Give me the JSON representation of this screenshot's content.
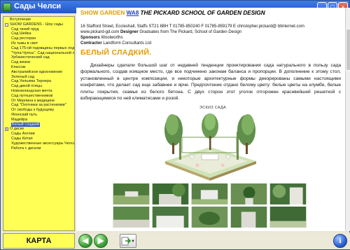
{
  "window": {
    "title": "Сады Челси"
  },
  "sidebar": {
    "items": [
      {
        "label": "Вступление",
        "indent": 0,
        "box": ""
      },
      {
        "label": "SHOW GARDENS - Шоу сады",
        "indent": 0,
        "box": "−"
      },
      {
        "label": "Сад тихий пруд",
        "indent": 1,
        "box": ""
      },
      {
        "label": "Сад Шейка",
        "indent": 1,
        "box": ""
      },
      {
        "label": "Сад ресторан",
        "indent": 1,
        "box": ""
      },
      {
        "label": "Из тьмы в свет",
        "indent": 1,
        "box": ""
      },
      {
        "label": "Сад 175-ой годовщины первых лодок",
        "indent": 1,
        "box": ""
      },
      {
        "label": "\"Чупа-Чупсы\". Сад национальной лот",
        "indent": 1,
        "box": ""
      },
      {
        "label": "Урбанистический сад",
        "indent": 1,
        "box": ""
      },
      {
        "label": "Сад жизни",
        "indent": 1,
        "box": ""
      },
      {
        "label": "Классик",
        "indent": 1,
        "box": ""
      },
      {
        "label": "Австралийское вдохновение",
        "indent": 1,
        "box": ""
      },
      {
        "label": "Зеленый сад",
        "indent": 1,
        "box": ""
      },
      {
        "label": "Сад Уильяма Тернера",
        "indent": 1,
        "box": ""
      },
      {
        "label": "Сад дикой птицы",
        "indent": 1,
        "box": ""
      },
      {
        "label": "Новозеландская мечта",
        "indent": 1,
        "box": ""
      },
      {
        "label": "Сад путешественников",
        "indent": 1,
        "box": ""
      },
      {
        "label": "От Мерлина к медицине",
        "indent": 1,
        "box": ""
      },
      {
        "label": "Сад \"Охотники за растениями\"",
        "indent": 1,
        "box": ""
      },
      {
        "label": "От свободы к будущему",
        "indent": 1,
        "box": ""
      },
      {
        "label": "Японский путь",
        "indent": 1,
        "box": ""
      },
      {
        "label": "Мадейра",
        "indent": 1,
        "box": ""
      },
      {
        "label": "Белый сладкий",
        "indent": 1,
        "box": "",
        "selected": true
      },
      {
        "label": "О диске",
        "indent": 0,
        "box": "+"
      },
      {
        "label": "Сады Англии",
        "indent": 1,
        "box": ""
      },
      {
        "label": "Сады Китая",
        "indent": 1,
        "box": ""
      },
      {
        "label": "Художественные аксессуары Челси",
        "indent": 1,
        "box": ""
      },
      {
        "label": "Работа с диском",
        "indent": 1,
        "box": ""
      }
    ],
    "map_button": "КАРТА"
  },
  "content": {
    "heading": {
      "show_garden": "SHOW GARDEN",
      "code": "WA8",
      "school": "THE PICKARD SCHOOL OF GARDEN DESIGN"
    },
    "address": "16 Stafford Street, Eccleshall, Staffs ST21 6BH T 01785-850240 F 01785-859179 E christopher.pickard@ btinternet.com",
    "website": "www.pickard-gd.com",
    "designer_label": "Designer",
    "designer": "Graduates from The Pickard, School of Garden Design",
    "sponsors_label": "Sponsors",
    "sponsors": "Woolworths",
    "contractor_label": "Contractor",
    "contractor": "Landform Consultants Ltd",
    "garden_title": "БЕЛЫЙ СЛАДКИЙ.",
    "description": "Дизайнеры сделали большой шаг от недавней тенденции проектирования сада натурального в пользу сада формального, создав изящное место, где все подчинено законам баланса и пропорции. В дополнение к этому стол, установленный в центре композиции, и некоторые архитектурные формы декорированы самыми настоящими конфетами, что делает сад еще забавнее и ярче. Предпочтение отдано белому цвету: белые цветы на клумбе, белые плиты покрытия, скамья из белого бетона. С двух сторон этот уголок отгорожен красивейшей решеткой с взбирающимися по ней климатисами и розой.",
    "sketch_label": "ЭСКИЗ САДА"
  },
  "icons": {
    "back": "back-arrow-icon",
    "forward": "forward-arrow-icon",
    "export": "export-icon",
    "info": "info-icon"
  },
  "colors": {
    "titlebar": "#2357c9",
    "sidebar_bg": "#ffff55",
    "heading_orange": "#e39b00",
    "link_blue": "#1f3fb8",
    "selection": "#2a52be"
  }
}
